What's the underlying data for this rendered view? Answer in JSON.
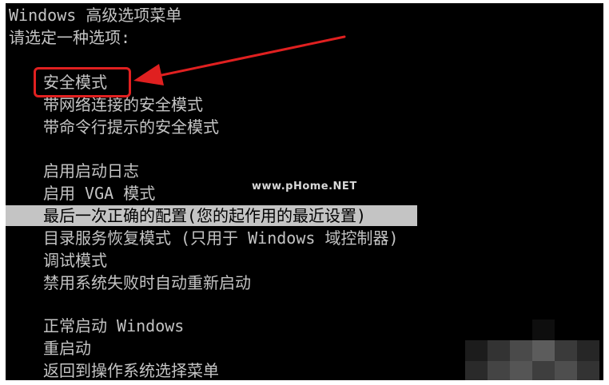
{
  "header": {
    "title": "Windows 高级选项菜单",
    "prompt": "请选定一种选项:"
  },
  "menu": {
    "group1": [
      {
        "label": "安全模式"
      },
      {
        "label": "带网络连接的安全模式"
      },
      {
        "label": "带命令行提示的安全模式"
      }
    ],
    "group2": [
      {
        "label": "启用启动日志"
      },
      {
        "label": "启用 VGA 模式"
      },
      {
        "label": "最后一次正确的配置(您的起作用的最近设置)",
        "selected": true
      },
      {
        "label": "目录服务恢复模式 (只用于 Windows 域控制器)"
      },
      {
        "label": "调试模式"
      },
      {
        "label": "禁用系统失败时自动重新启动"
      }
    ],
    "group3": [
      {
        "label": "正常启动 Windows"
      },
      {
        "label": "重启动"
      },
      {
        "label": "返回到操作系统选择菜单"
      }
    ]
  },
  "watermark": {
    "text": "www.pHome.NET"
  },
  "colors": {
    "background": "#000000",
    "text": "#c4c4c4",
    "selection_bg": "#c4c4c4",
    "selection_text": "#000000",
    "annotation": "#e02020"
  }
}
